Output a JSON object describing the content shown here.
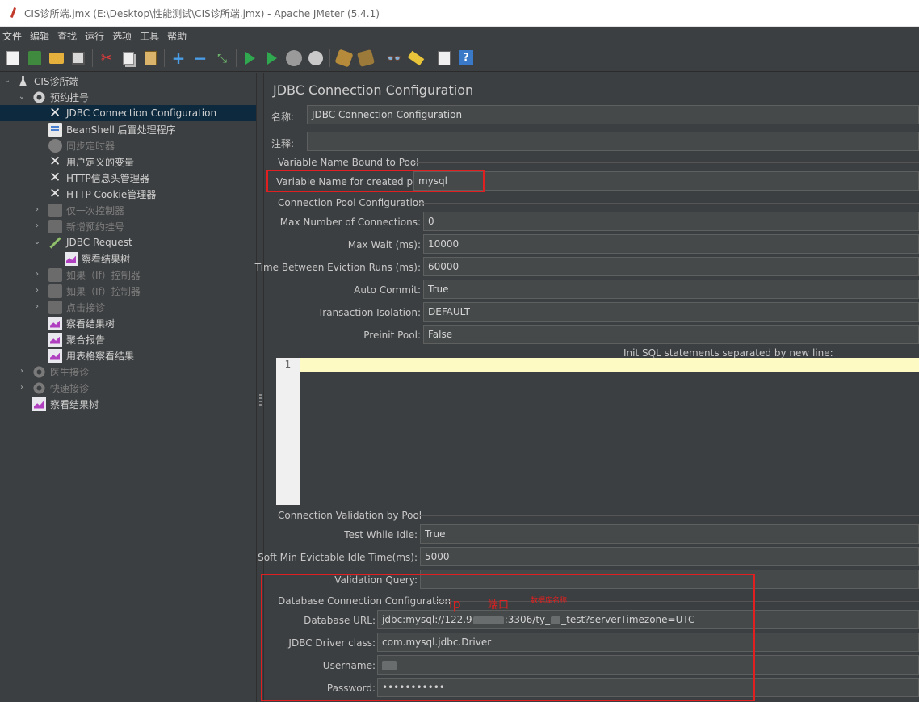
{
  "window": {
    "title": "CIS诊所端.jmx (E:\\Desktop\\性能测试\\CIS诊所端.jmx) - Apache JMeter (5.4.1)"
  },
  "menu": [
    "文件",
    "编辑",
    "查找",
    "运行",
    "选项",
    "工具",
    "帮助"
  ],
  "tree": {
    "items": [
      {
        "label": "CIS诊所端",
        "icon": "flask-icon",
        "disabled": false
      },
      {
        "label": "预约挂号",
        "icon": "gear-icon",
        "disabled": false
      },
      {
        "label": "JDBC Connection Configuration",
        "icon": "tools-icon",
        "disabled": false,
        "selected": true
      },
      {
        "label": "BeanShell 后置处理程序",
        "icon": "script-icon",
        "disabled": false
      },
      {
        "label": "同步定时器",
        "icon": "timer-icon",
        "disabled": true
      },
      {
        "label": "用户定义的变量",
        "icon": "tools-icon",
        "disabled": false
      },
      {
        "label": "HTTP信息头管理器",
        "icon": "tools-icon",
        "disabled": false
      },
      {
        "label": "HTTP Cookie管理器",
        "icon": "tools-icon",
        "disabled": false
      },
      {
        "label": "仅一次控制器",
        "icon": "controller-icon",
        "disabled": true
      },
      {
        "label": "新增预约挂号",
        "icon": "controller-icon",
        "disabled": true
      },
      {
        "label": "JDBC Request",
        "icon": "sampler-icon",
        "disabled": false
      },
      {
        "label": "察看结果树",
        "icon": "listener-icon",
        "disabled": false
      },
      {
        "label": "如果（If）控制器",
        "icon": "controller-icon",
        "disabled": true
      },
      {
        "label": "如果（If）控制器",
        "icon": "controller-icon",
        "disabled": true
      },
      {
        "label": "点击接诊",
        "icon": "controller-icon",
        "disabled": true
      },
      {
        "label": "察看结果树",
        "icon": "listener-icon",
        "disabled": false
      },
      {
        "label": "聚合报告",
        "icon": "listener-icon",
        "disabled": false
      },
      {
        "label": "用表格察看结果",
        "icon": "listener-icon",
        "disabled": false
      },
      {
        "label": "医生接诊",
        "icon": "gear-icon",
        "disabled": true
      },
      {
        "label": "快速接诊",
        "icon": "gear-icon",
        "disabled": true
      },
      {
        "label": "察看结果树",
        "icon": "listener-icon",
        "disabled": false
      }
    ]
  },
  "form": {
    "title": "JDBC Connection Configuration",
    "name_label": "名称:",
    "name_value": "JDBC Connection Configuration",
    "comment_label": "注释:",
    "comment_value": "",
    "section_pool_name": "Variable Name Bound to Pool",
    "var_name_label": "Variable Name for created pool:",
    "var_name_value": "mysql",
    "section_pool_config": "Connection Pool Configuration",
    "max_conn_label": "Max Number of Connections:",
    "max_conn_value": "0",
    "max_wait_label": "Max Wait (ms):",
    "max_wait_value": "10000",
    "eviction_label": "Time Between Eviction Runs (ms):",
    "eviction_value": "60000",
    "auto_commit_label": "Auto Commit:",
    "auto_commit_value": "True",
    "isolation_label": "Transaction Isolation:",
    "isolation_value": "DEFAULT",
    "preinit_label": "Preinit Pool:",
    "preinit_value": "False",
    "init_sql_label": "Init SQL statements separated by new line:",
    "line_number": "1",
    "section_validation": "Connection Validation by Pool",
    "test_idle_label": "Test While Idle:",
    "test_idle_value": "True",
    "soft_min_label": "Soft Min Evictable Idle Time(ms):",
    "soft_min_value": "5000",
    "validation_query_label": "Validation Query:",
    "validation_query_value": "",
    "section_db": "Database Connection Configuration",
    "db_url_label": "Database URL:",
    "db_url_part1": "jdbc:mysql://122.9",
    "db_url_part2": ":3306/ty_",
    "db_url_part3": "_test?serverTimezone=UTC",
    "driver_label": "JDBC Driver class:",
    "driver_value": "com.mysql.jdbc.Driver",
    "username_label": "Username:",
    "password_label": "Password:",
    "password_value": "•••••••••••"
  },
  "annotations": {
    "ip": "ip",
    "port": "端口",
    "dbname": "数据库名称",
    "color": "#e02020"
  }
}
